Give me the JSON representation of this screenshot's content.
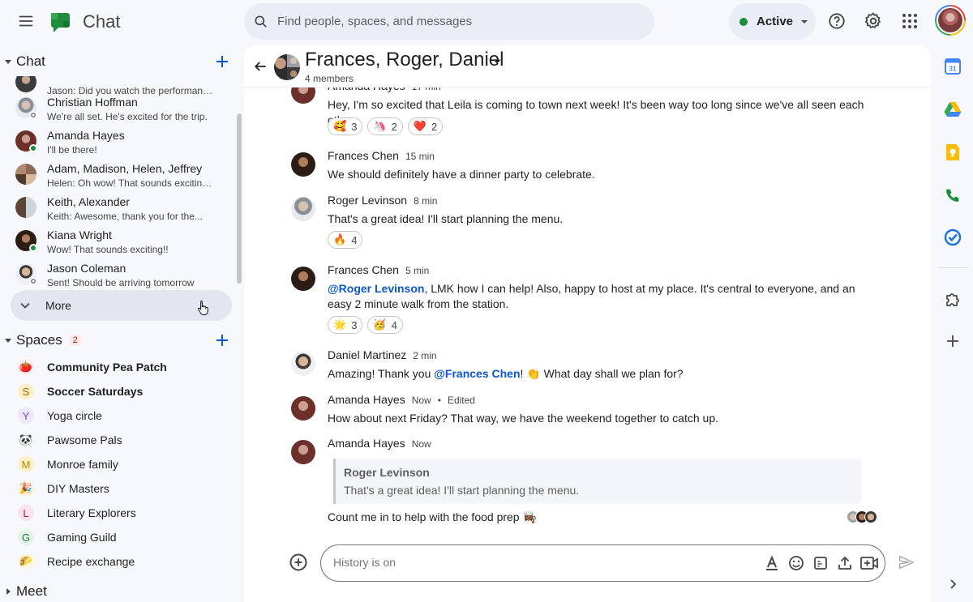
{
  "app": {
    "title": "Chat",
    "logo_icon": "google-chat-logo"
  },
  "search": {
    "placeholder": "Find people, spaces, and messages"
  },
  "status": {
    "label": "Active",
    "color": "#1e8e3e"
  },
  "sidebar": {
    "chat_section": {
      "title": "Chat"
    },
    "dms": [
      {
        "name": "",
        "preview": "Jason: Did you watch the performan ...",
        "presence": "none"
      },
      {
        "name": "Christian Hoffman",
        "preview": "We're all set.  He's excited for the trip.",
        "presence": "away"
      },
      {
        "name": "Amanda Hayes",
        "preview": "I'll be there!",
        "presence": "active"
      },
      {
        "name": "Adam, Madison, Helen, Jeffrey",
        "preview": "Helen: Oh wow! That sounds exciting ...",
        "presence": "none"
      },
      {
        "name": "Keith, Alexander",
        "preview": "Keith: Awesome, thank you for the...",
        "presence": "none"
      },
      {
        "name": "Kiana Wright",
        "preview": "Wow!  That sounds exciting!!",
        "presence": "active"
      },
      {
        "name": "Jason Coleman",
        "preview": "Sent!  Should be arriving tomorrow",
        "presence": "away"
      }
    ],
    "more_label": "More",
    "spaces_section": {
      "title": "Spaces",
      "badge": "2"
    },
    "spaces": [
      {
        "name": "Community Pea Patch",
        "icon": "🍅",
        "bold": true
      },
      {
        "name": "Soccer Saturdays",
        "icon": "S",
        "bold": true
      },
      {
        "name": "Yoga circle",
        "icon": "Y",
        "bold": false
      },
      {
        "name": "Pawsome Pals",
        "icon": "🐼",
        "bold": false
      },
      {
        "name": "Monroe family",
        "icon": "M",
        "bold": false
      },
      {
        "name": "DIY Masters",
        "icon": "🎉",
        "bold": false
      },
      {
        "name": "Literary Explorers",
        "icon": "L",
        "bold": false
      },
      {
        "name": "Gaming Guild",
        "icon": "G",
        "bold": false
      },
      {
        "name": "Recipe exchange",
        "icon": "🌮",
        "bold": false
      }
    ],
    "meet_section": {
      "title": "Meet"
    }
  },
  "conversation": {
    "title": "Frances, Roger, Daniel",
    "members": "4 members",
    "messages": [
      {
        "sender": "Amanda Hayes",
        "time": "17 min",
        "text": "Hey, I'm so excited that Leila is coming to town next week! It's been way too long since we've all seen each other.",
        "reactions": [
          {
            "emoji": "🥰",
            "count": "3"
          },
          {
            "emoji": "🦄",
            "count": "2"
          },
          {
            "emoji": "❤️",
            "count": "2"
          }
        ]
      },
      {
        "sender": "Frances Chen",
        "time": "15 min",
        "text": "We should definitely have a dinner party to celebrate."
      },
      {
        "sender": "Roger Levinson",
        "time": "8 min",
        "text": "That's a great idea! I'll start planning the menu.",
        "reactions": [
          {
            "emoji": "🔥",
            "count": "4"
          }
        ]
      },
      {
        "sender": "Frances Chen",
        "time": "5 min",
        "mention": "@Roger Levinson",
        "text_after": ", LMK how I can help!  Also, happy to host at my place. It's central to everyone, and an easy 2 minute walk from the station.",
        "reactions": [
          {
            "emoji": "🌟",
            "count": "3"
          },
          {
            "emoji": "🥳",
            "count": "4"
          }
        ]
      },
      {
        "sender": "Daniel Martinez",
        "time": "2 min",
        "text_before": "Amazing! Thank you ",
        "mention": "@Frances Chen",
        "text_after": "! 👏 What day shall we plan for?"
      },
      {
        "sender": "Amanda Hayes",
        "time": "Now",
        "separator": "•",
        "edited": "Edited",
        "text": "How about next Friday? That way, we have the weekend together to catch up."
      },
      {
        "sender": "Amanda Hayes",
        "time": "Now",
        "quote_sender": "Roger Levinson",
        "quote_text": "That's a great idea! I'll start planning the menu.",
        "text": "Count me in to help with the food prep 👩🏾‍🍳"
      }
    ]
  },
  "composer": {
    "placeholder": "History is on"
  }
}
